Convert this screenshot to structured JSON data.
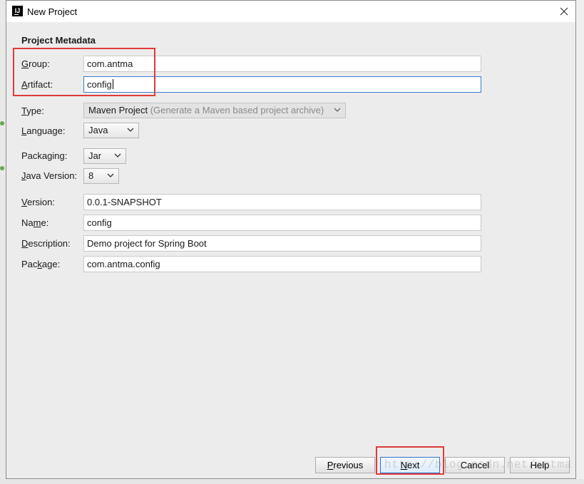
{
  "window": {
    "title": "New Project",
    "app_icon_text": "IJ"
  },
  "form": {
    "section_title": "Project Metadata",
    "group": {
      "label_key": "G",
      "label_rest": "roup:",
      "value": "com.antma"
    },
    "artifact": {
      "label_key": "A",
      "label_rest": "rtifact:",
      "value": "config"
    },
    "type": {
      "label_key": "T",
      "label_rest": "ype:",
      "value": "Maven Project",
      "hint": "(Generate a Maven based project archive)"
    },
    "language": {
      "label_key": "L",
      "label_rest": "anguage:",
      "value": "Java"
    },
    "packaging": {
      "label_pre": "Packa",
      "label_key": "g",
      "label_rest": "ing:",
      "value": "Jar"
    },
    "java_version": {
      "label_key": "J",
      "label_rest": "ava Version:",
      "value": "8"
    },
    "version": {
      "label_key": "V",
      "label_rest": "ersion:",
      "value": "0.0.1-SNAPSHOT"
    },
    "name": {
      "label_pre": "Na",
      "label_key": "m",
      "label_rest": "e:",
      "value": "config"
    },
    "description": {
      "label_key": "D",
      "label_rest": "escription:",
      "value": "Demo project for Spring Boot"
    },
    "package": {
      "label_pre": "Pac",
      "label_key": "k",
      "label_rest": "age:",
      "value": "com.antma.config"
    }
  },
  "buttons": {
    "previous_key": "P",
    "previous_rest": "revious",
    "next_key": "N",
    "next_rest": "ext",
    "cancel": "Cancel",
    "help": "Help"
  },
  "watermark": "http://blog.csdn.net/antma",
  "colors": {
    "highlight": "#e03a3a",
    "focus": "#3d7bd2"
  }
}
